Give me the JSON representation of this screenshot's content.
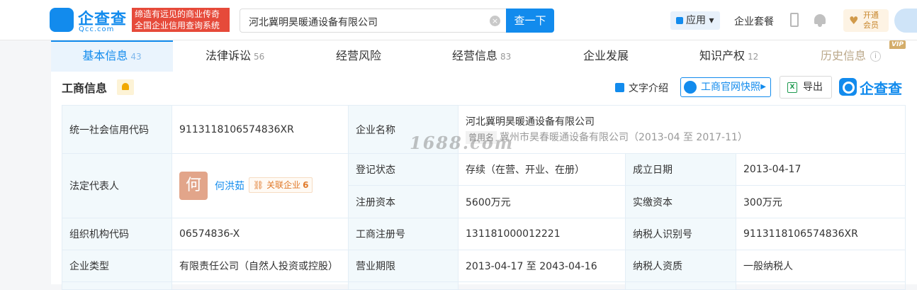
{
  "header": {
    "logo_name": "企查查",
    "logo_sub": "Qcc.com",
    "slogan_line1": "缔造有远见的商业传奇",
    "slogan_line2": "全国企业信用查询系统",
    "search_value": "河北冀明昊暖通设备有限公司",
    "search_button": "查一下",
    "apps_label": "应用",
    "suite_label": "企业套餐",
    "vip_line1": "开通",
    "vip_line2": "会员"
  },
  "tabs": [
    {
      "label": "基本信息",
      "count": "43"
    },
    {
      "label": "法律诉讼",
      "count": "56"
    },
    {
      "label": "经营风险",
      "count": ""
    },
    {
      "label": "经营信息",
      "count": "83"
    },
    {
      "label": "企业发展",
      "count": ""
    },
    {
      "label": "知识产权",
      "count": "12"
    },
    {
      "label": "历史信息",
      "count": "",
      "badge": "VIP"
    }
  ],
  "section": {
    "title": "工商信息",
    "text_intro": "文字介绍",
    "snapshot": "工商官网快照",
    "export": "导出",
    "brand": "企查查"
  },
  "table": {
    "credit_code_label": "统一社会信用代码",
    "credit_code": "9113118106574836XR",
    "company_name_label": "企业名称",
    "company_name": "河北冀明昊暖通设备有限公司",
    "former_tag": "曾用名",
    "former_name": "冀州市昊春暖通设备有限公司（2013-04 至 2017-11）",
    "legal_rep_label": "法定代表人",
    "legal_rep_avatar": "何",
    "legal_rep": "何洪茹",
    "related_label": "关联企业",
    "related_count": "6",
    "reg_status_label": "登记状态",
    "reg_status": "存续（在营、开业、在册）",
    "est_date_label": "成立日期",
    "est_date": "2013-04-17",
    "reg_capital_label": "注册资本",
    "reg_capital": "5600万元",
    "paid_capital_label": "实缴资本",
    "paid_capital": "300万元",
    "org_code_label": "组织机构代码",
    "org_code": "06574836-X",
    "biz_reg_no_label": "工商注册号",
    "biz_reg_no": "131181000012221",
    "taxpayer_id_label": "纳税人识别号",
    "taxpayer_id": "9113118106574836XR",
    "company_type_label": "企业类型",
    "company_type": "有限责任公司（自然人投资或控股）",
    "biz_term_label": "营业期限",
    "biz_term": "2013-04-17 至 2043-04-16",
    "taxpayer_qual_label": "纳税人资质",
    "taxpayer_qual": "一般纳税人"
  },
  "watermark": "1688.com"
}
